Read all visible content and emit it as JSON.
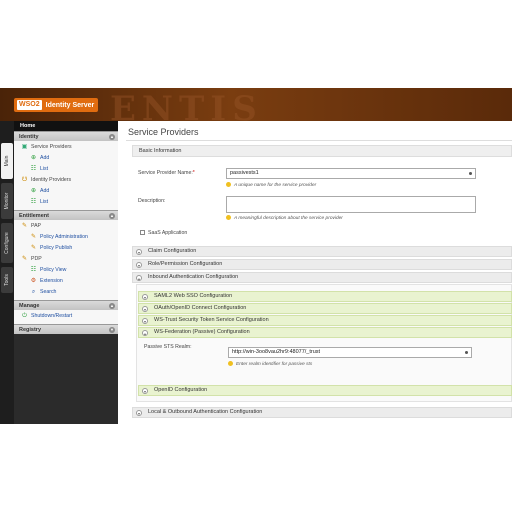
{
  "header": {
    "logo_mark": "WSO2",
    "product_name": "Identity Server",
    "bg_text": "ENTIS"
  },
  "vertical_tabs": [
    "Main",
    "Monitor",
    "Configure",
    "Tools"
  ],
  "sidebar": {
    "home": "Home",
    "sections": {
      "identity": {
        "title": "Identity",
        "service_providers": "Service Providers",
        "sp_add": "Add",
        "sp_list": "List",
        "identity_providers": "Identity Providers",
        "idp_add": "Add",
        "idp_list": "List"
      },
      "entitlement": {
        "title": "Entitlement",
        "pap": "PAP",
        "policy_administration": "Policy Administration",
        "policy_publish": "Policy Publish",
        "pdp": "PDP",
        "policy_view": "Policy View",
        "extension": "Extension",
        "search": "Search"
      },
      "manage": {
        "title": "Manage",
        "shutdown": "Shutdown/Restart"
      },
      "registry": {
        "title": "Registry"
      }
    }
  },
  "main": {
    "page_title": "Service Providers",
    "basic_info": "Basic Information",
    "sp_name_label": "Service Provider Name:",
    "sp_name_required": "*",
    "sp_name_value": "passivests1",
    "sp_name_hint": "A unique name for the service provider",
    "description_label": "Description:",
    "description_hint": "A meaningful description about the service provider",
    "saas_label": "SaaS Application",
    "claim_config": "Claim Configuration",
    "role_config": "Role/Permission Configuration",
    "inbound_config": "Inbound Authentication Configuration",
    "saml_config": "SAML2 Web SSO Configuration",
    "oauth_config": "OAuth/OpenID Connect Configuration",
    "wstrust_config": "WS-Trust Security Token Service Configuration",
    "wsfed_config": "WS-Federation (Passive) Configuration",
    "passive_realm_label": "Passive STS Realm:",
    "passive_realm_value": "http://win-3oo8vau2hr9:48077/_trust",
    "passive_realm_hint": "Enter realm identifier for passive sts",
    "openid_config": "OpenID Configuration",
    "local_outbound_config": "Local & Outbound Authentication Configuration"
  },
  "colors": {
    "accent": "#e06c10",
    "header_brown": "#6a330c",
    "link": "#1f4fa1"
  }
}
